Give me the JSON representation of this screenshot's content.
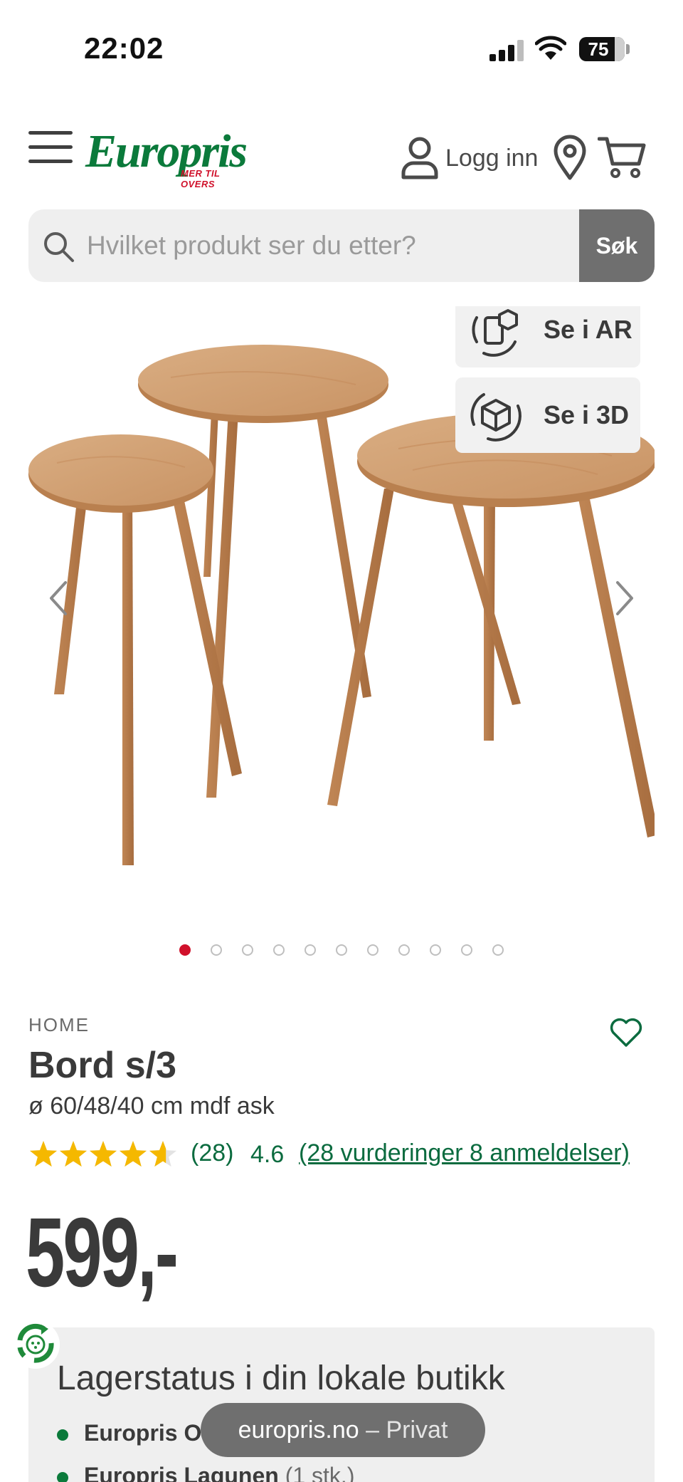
{
  "status_bar": {
    "time": "22:02",
    "battery": "75"
  },
  "header": {
    "logo_text": "Europris",
    "logo_tagline": "MER TIL OVERS",
    "login_label": "Logg inn",
    "icons": [
      "menu-icon",
      "user-icon",
      "location-pin-icon",
      "cart-icon"
    ]
  },
  "search": {
    "placeholder": "Hvilket produkt ser du etter?",
    "button_label": "Søk"
  },
  "gallery": {
    "ar_label": "Se i AR",
    "view3d_label": "Se i 3D",
    "image_count": 11,
    "active_index": 0
  },
  "product": {
    "brand": "HOME",
    "title": "Bord s/3",
    "subtitle": "ø 60/48/40 cm mdf ask",
    "rating_stars": 4.6,
    "rating_count": "(28)",
    "rating_average": "4.6",
    "reviews_link": "(28 vurderinger 8 anmeldelser)",
    "price": "599,-"
  },
  "stock": {
    "heading": "Lagerstatus i din lokale butikk",
    "stores": [
      {
        "name": "Europris Os",
        "qty": ""
      },
      {
        "name": "Europris Lagunen",
        "qty": "(1 stk.)"
      }
    ]
  },
  "browser": {
    "domain": "europris.no",
    "mode": "– Privat"
  },
  "colors": {
    "brand_green": "#0b7a3b",
    "brand_red": "#d0112b",
    "star": "#f5b800",
    "link_green": "#0b6b3f"
  }
}
